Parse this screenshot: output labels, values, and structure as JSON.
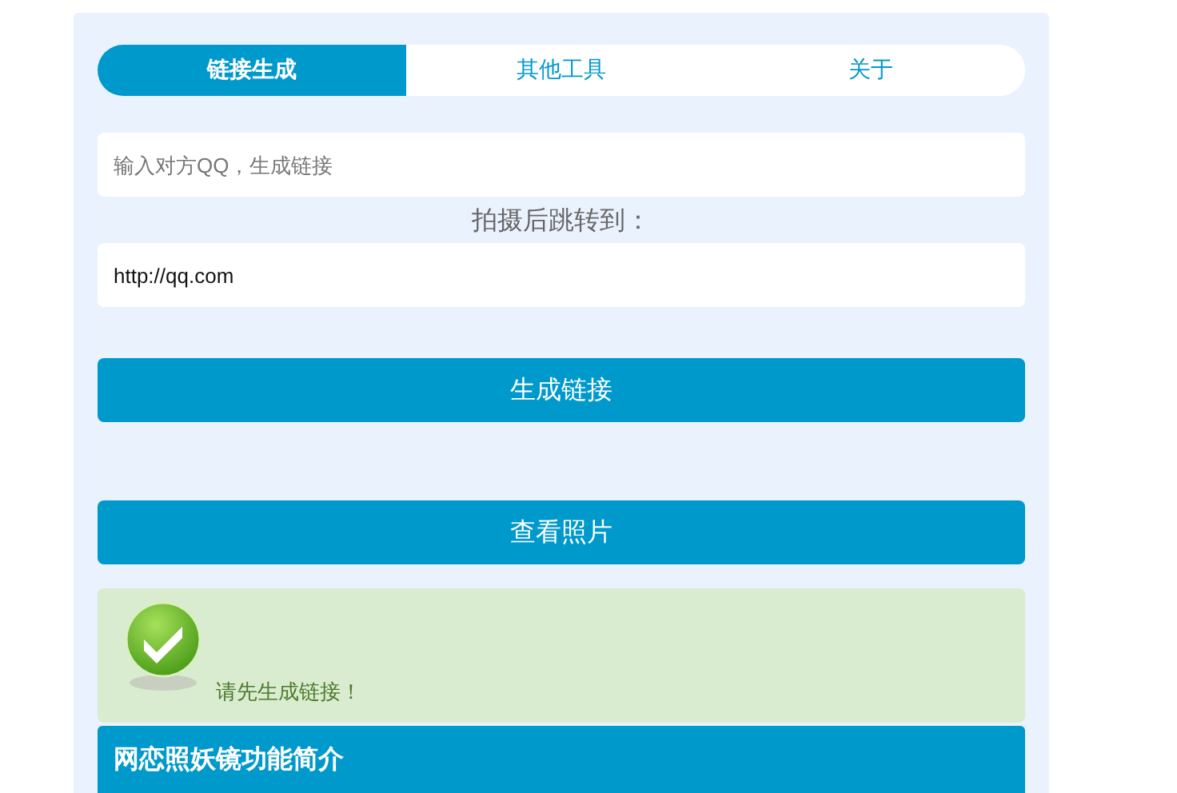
{
  "tabs": [
    {
      "label": "链接生成",
      "selected": true
    },
    {
      "label": "其他工具",
      "selected": false
    },
    {
      "label": "关于",
      "selected": false
    }
  ],
  "qq_field": {
    "placeholder": "输入对方QQ，生成链接"
  },
  "redirect_label": "拍摄后跳转到：",
  "redirect_field": {
    "value": "http://qq.com"
  },
  "generate_button": "生成链接",
  "view_button": "查看照片",
  "alert": {
    "message": "请先生成链接！"
  },
  "intro": {
    "title": "网恋照妖镜功能简介"
  }
}
